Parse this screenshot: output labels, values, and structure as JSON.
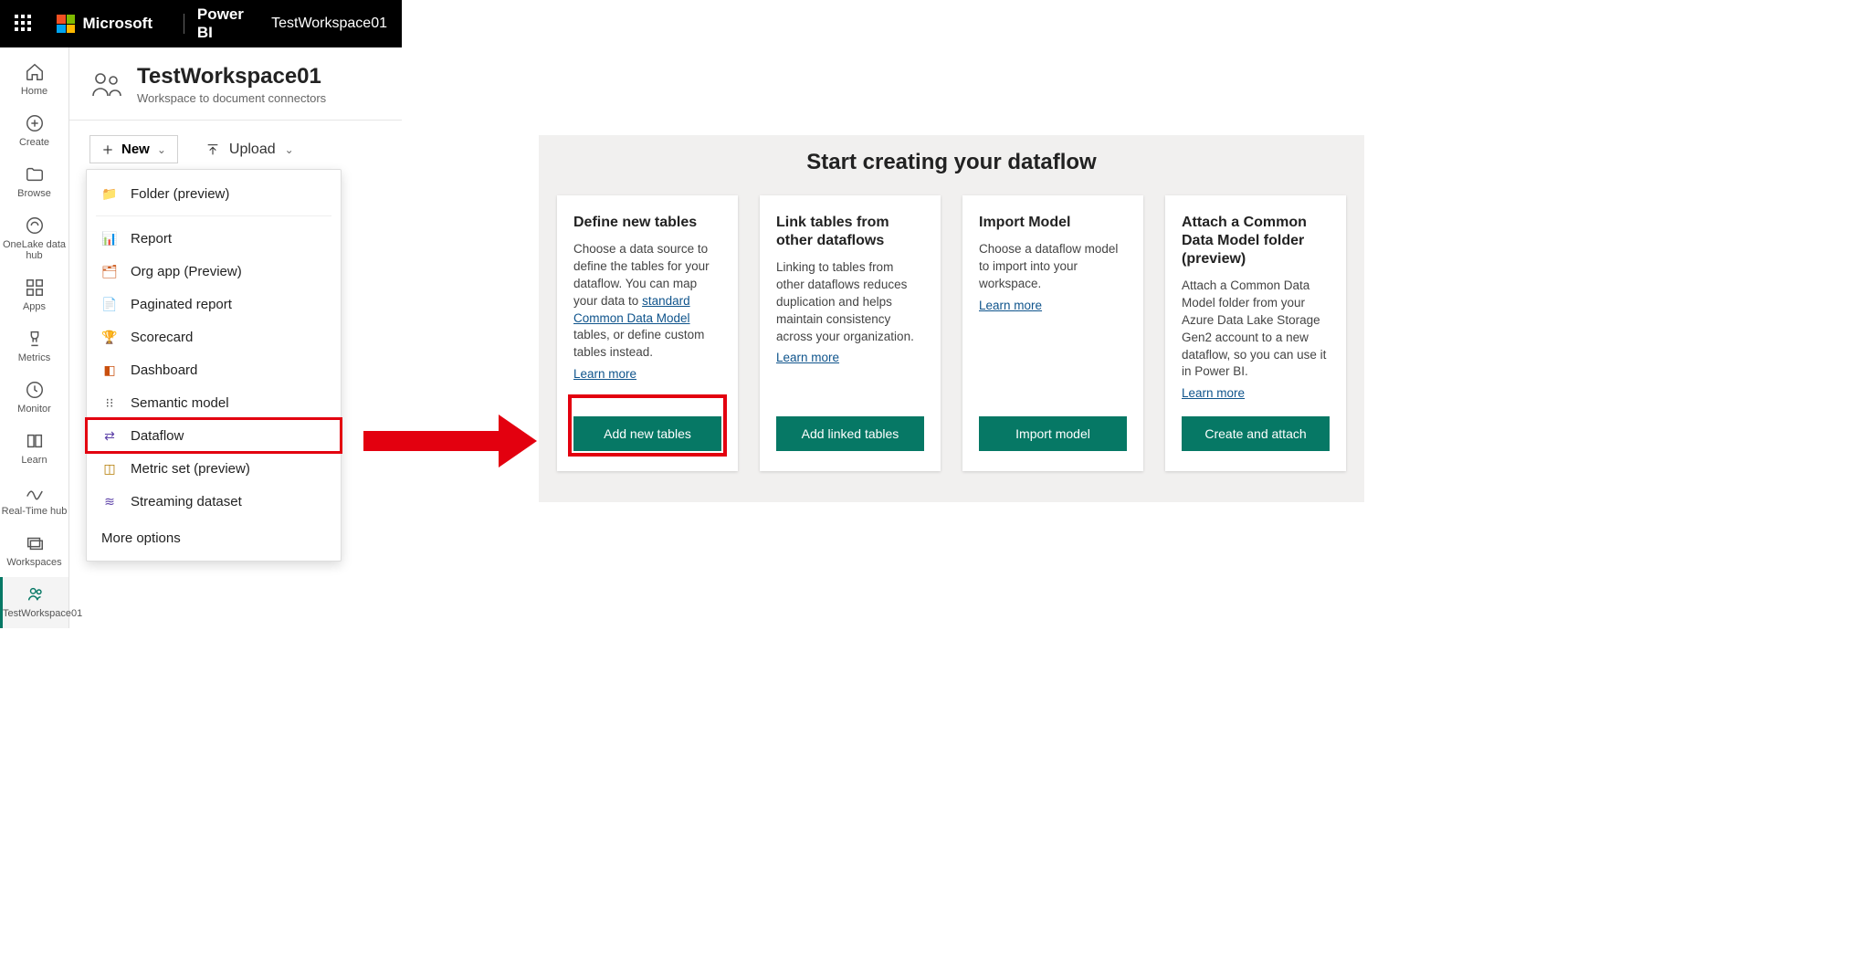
{
  "header": {
    "microsoft": "Microsoft",
    "product": "Power BI",
    "workspace": "TestWorkspace01"
  },
  "nav": {
    "home": "Home",
    "create": "Create",
    "browse": "Browse",
    "onelake": "OneLake data hub",
    "apps": "Apps",
    "metrics": "Metrics",
    "monitor": "Monitor",
    "learn": "Learn",
    "realtime": "Real-Time hub",
    "workspaces": "Workspaces",
    "active_ws": "TestWorkspace01"
  },
  "workspace": {
    "title": "TestWorkspace01",
    "subtitle": "Workspace to document connectors"
  },
  "toolbar": {
    "new": "New",
    "upload": "Upload"
  },
  "new_menu": {
    "folder": "Folder (preview)",
    "report": "Report",
    "orgapp": "Org app (Preview)",
    "paginated": "Paginated report",
    "scorecard": "Scorecard",
    "dashboard": "Dashboard",
    "semantic": "Semantic model",
    "dataflow": "Dataflow",
    "metricset": "Metric set (preview)",
    "streaming": "Streaming dataset",
    "more": "More options"
  },
  "right": {
    "title": "Start creating your dataflow",
    "cards": {
      "define": {
        "title": "Define new tables",
        "body1": "Choose a data source to define the tables for your dataflow. You can map your data to ",
        "link1": "standard Common Data Model",
        "body2": " tables, or define custom tables instead.",
        "learn": "Learn more",
        "cta": "Add new tables"
      },
      "link": {
        "title": "Link tables from other dataflows",
        "body": "Linking to tables from other dataflows reduces duplication and helps maintain consistency across your organization.",
        "learn": "Learn more",
        "cta": "Add linked tables"
      },
      "import": {
        "title": "Import Model",
        "body": "Choose a dataflow model to import into your workspace.",
        "learn": "Learn more",
        "cta": "Import model"
      },
      "cdm": {
        "title": "Attach a Common Data Model folder (preview)",
        "body": "Attach a Common Data Model folder from your Azure Data Lake Storage Gen2 account to a new dataflow, so you can use it in Power BI.",
        "learn": "Learn more",
        "cta": "Create and attach"
      }
    }
  }
}
